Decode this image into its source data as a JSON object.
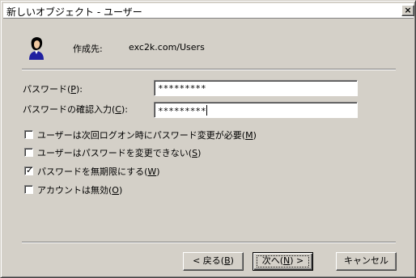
{
  "window": {
    "title": "新しいオブジェクト - ユーザー",
    "close_glyph": "×"
  },
  "header": {
    "create_in_label": "作成先:",
    "create_in_value": "exc2k.com/Users",
    "icon": "user-icon"
  },
  "password": {
    "label": "パスワード(",
    "accel": "P",
    "label_end": "):",
    "value": "*********"
  },
  "confirm": {
    "label": "パスワードの確認入力(",
    "accel": "C",
    "label_end": "):",
    "value": "*********"
  },
  "options": [
    {
      "text": "ユーザーは次回ログオン時にパスワード変更が必要(",
      "accel": "M",
      "end": ")",
      "checked": false
    },
    {
      "text": "ユーザーはパスワードを変更できない(",
      "accel": "S",
      "end": ")",
      "checked": false
    },
    {
      "text": "パスワードを無期限にする(",
      "accel": "W",
      "end": ")",
      "checked": true
    },
    {
      "text": "アカウントは無効(",
      "accel": "O",
      "end": ")",
      "checked": false
    }
  ],
  "check_glyph": "✓",
  "buttons": {
    "back": {
      "text": "< 戻る(",
      "accel": "B",
      "end": ")"
    },
    "next": {
      "text": "次へ(",
      "accel": "N",
      "end": ") >"
    },
    "cancel": {
      "text": "キャンセル"
    }
  }
}
